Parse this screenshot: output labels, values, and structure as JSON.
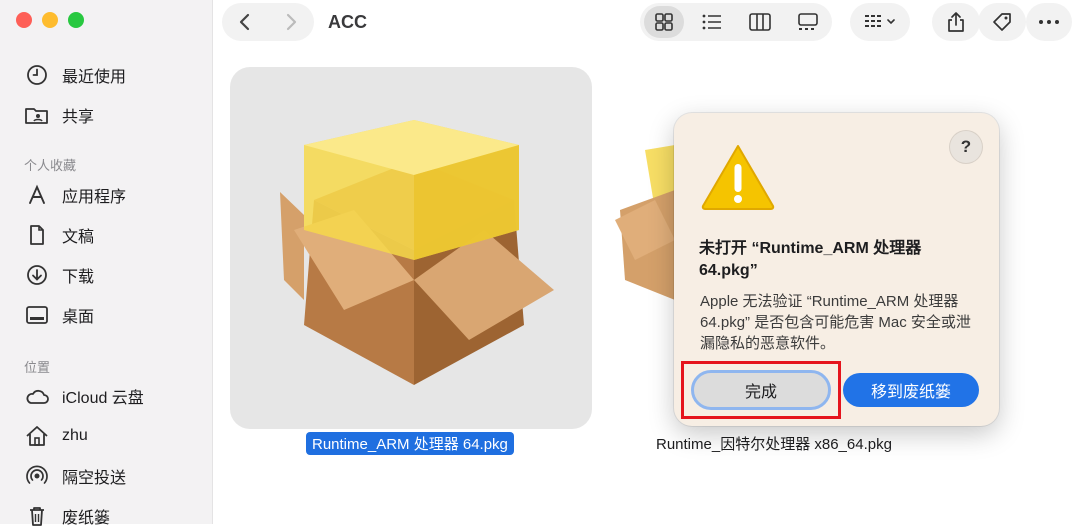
{
  "window": {
    "title": "ACC"
  },
  "sidebar": {
    "items_top": [
      {
        "label": "最近使用",
        "icon": "clock-icon"
      },
      {
        "label": "共享",
        "icon": "shared-folder-icon"
      }
    ],
    "favorites_header": "个人收藏",
    "favorites": [
      {
        "label": "应用程序",
        "icon": "applications-icon"
      },
      {
        "label": "文稿",
        "icon": "document-icon"
      },
      {
        "label": "下载",
        "icon": "download-icon"
      },
      {
        "label": "桌面",
        "icon": "desktop-icon"
      }
    ],
    "locations_header": "位置",
    "locations": [
      {
        "label": "iCloud 云盘",
        "icon": "cloud-icon"
      },
      {
        "label": "zhu",
        "icon": "home-icon"
      },
      {
        "label": "隔空投送",
        "icon": "airdrop-icon"
      },
      {
        "label": "废纸篓",
        "icon": "trash-icon"
      }
    ]
  },
  "files": [
    {
      "name": "Runtime_ARM 处理器 64.pkg",
      "selected": true
    },
    {
      "name": "Runtime_因特尔处理器 x86_64.pkg",
      "selected": false
    }
  ],
  "dialog": {
    "title": "未打开 “Runtime_ARM 处理器 64.pkg”",
    "message": "Apple 无法验证 “Runtime_ARM 处理器 64.pkg” 是否包含可能危害 Mac 安全或泄漏隐私的恶意软件。",
    "help_label": "?",
    "done_label": "完成",
    "trash_label": "移到废纸篓"
  },
  "colors": {
    "accent": "#2173e7",
    "highlight": "#e5141d",
    "warning": "#f5c400"
  }
}
